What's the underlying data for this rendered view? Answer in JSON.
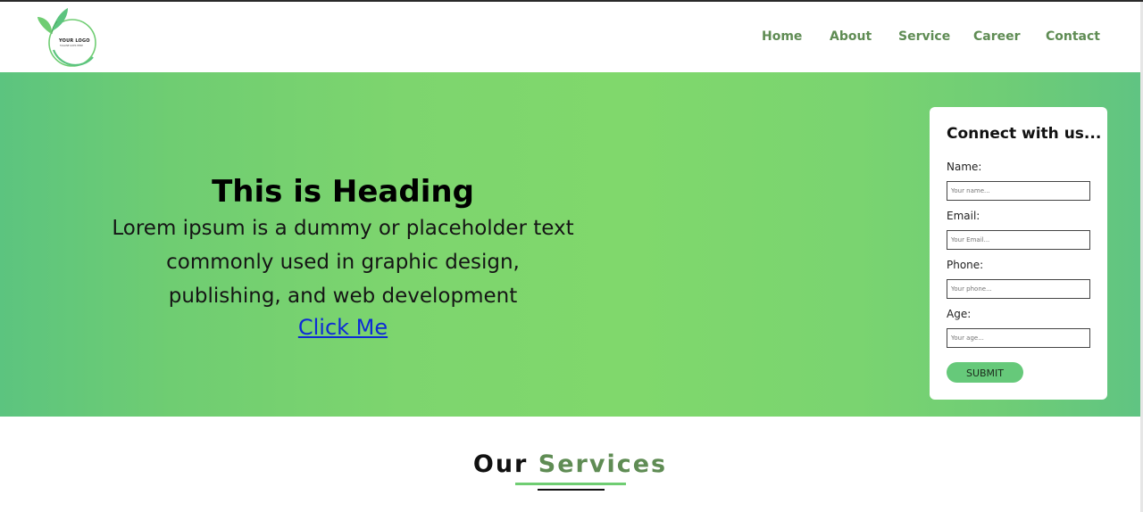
{
  "header": {
    "logo": {
      "text": "YOUR LOGO",
      "tagline": "TAGLINE GOES HERE",
      "icon": "leaf-icon"
    },
    "nav": [
      {
        "label": "Home"
      },
      {
        "label": "About"
      },
      {
        "label": "Service"
      },
      {
        "label": "Career"
      },
      {
        "label": "Contact"
      }
    ]
  },
  "hero": {
    "title": "This is Heading",
    "body_lines": [
      "Lorem ipsum is a dummy or placeholder text",
      "commonly used in graphic design,",
      "publishing, and web development"
    ],
    "link": "Click Me"
  },
  "form": {
    "title": "Connect with us...",
    "fields": [
      {
        "label": "Name:",
        "placeholder": "Your name..."
      },
      {
        "label": "Email:",
        "placeholder": "Your Email..."
      },
      {
        "label": "Phone:",
        "placeholder": "Your phone..."
      },
      {
        "label": "Age:",
        "placeholder": "Your age..."
      }
    ],
    "submit": "SUBMIT"
  },
  "services": {
    "title_part1": "Our",
    "title_part2": "Services"
  },
  "colors": {
    "brand_green": "#5f8c54",
    "hero_green": "#80d86c",
    "button_green": "#66c97a",
    "link_blue": "#0d2bd6"
  }
}
